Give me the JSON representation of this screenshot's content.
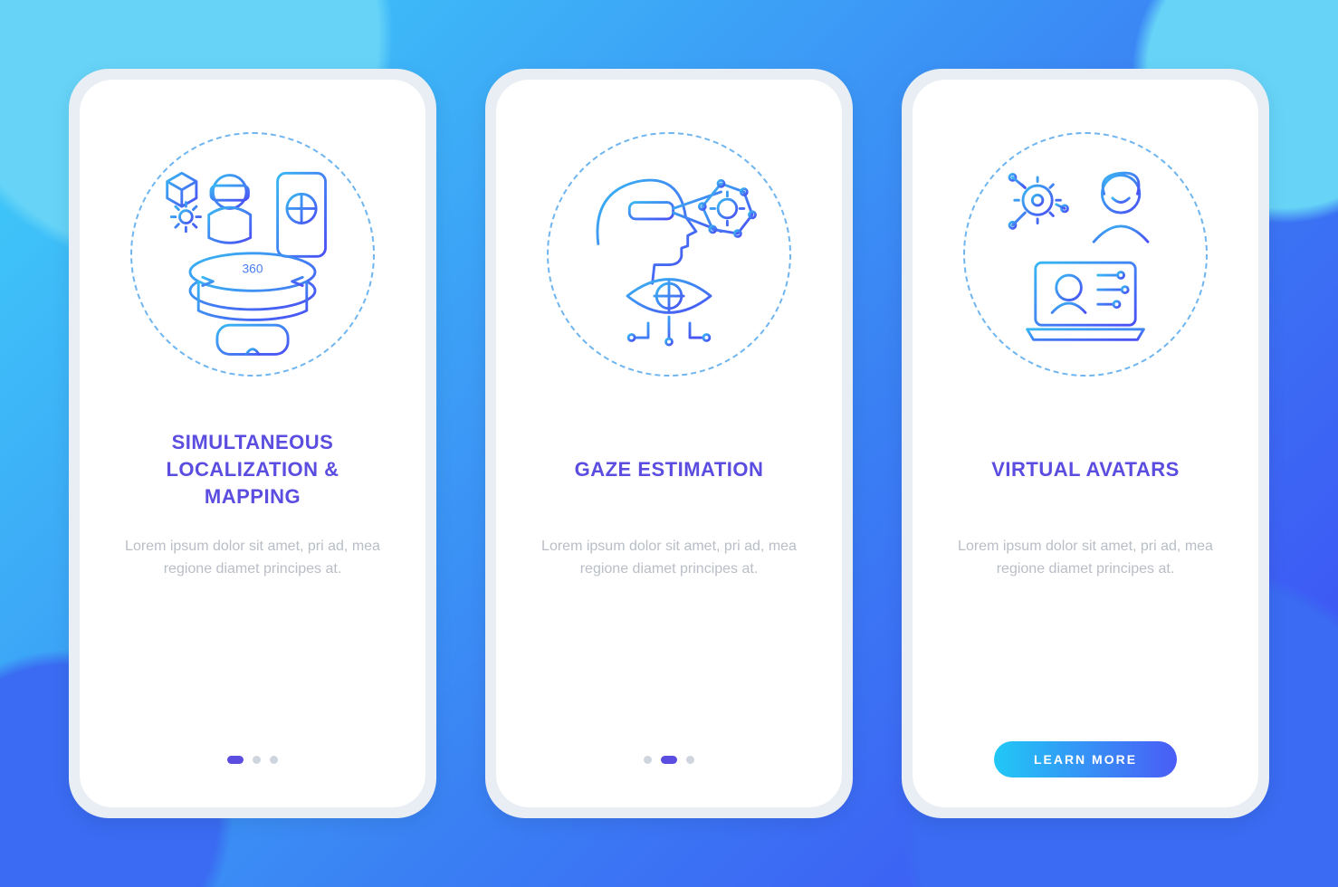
{
  "colors": {
    "accent": "#5a4de0",
    "bg_start": "#3fd1f9",
    "bg_end": "#3f4af4",
    "cta_start": "#21c8f6",
    "cta_end": "#4a5cf6"
  },
  "cta_label": "LEARN MORE",
  "screens": [
    {
      "id": "slam",
      "title": "SIMULTANEOUS\nLOCALIZATION &\nMAPPING",
      "body": "Lorem ipsum dolor sit amet, pri ad, mea regione diamet principes at.",
      "icon": "vr-360-icon",
      "active_dot": 0,
      "has_cta": false
    },
    {
      "id": "gaze",
      "title": "GAZE ESTIMATION",
      "body": "Lorem ipsum dolor sit amet, pri ad, mea regione diamet principes at.",
      "icon": "eye-tracking-icon",
      "active_dot": 1,
      "has_cta": false
    },
    {
      "id": "avatars",
      "title": "VIRTUAL AVATARS",
      "body": "Lorem ipsum dolor sit amet, pri ad, mea regione diamet principes at.",
      "icon": "avatar-network-icon",
      "active_dot": 2,
      "has_cta": true
    }
  ]
}
